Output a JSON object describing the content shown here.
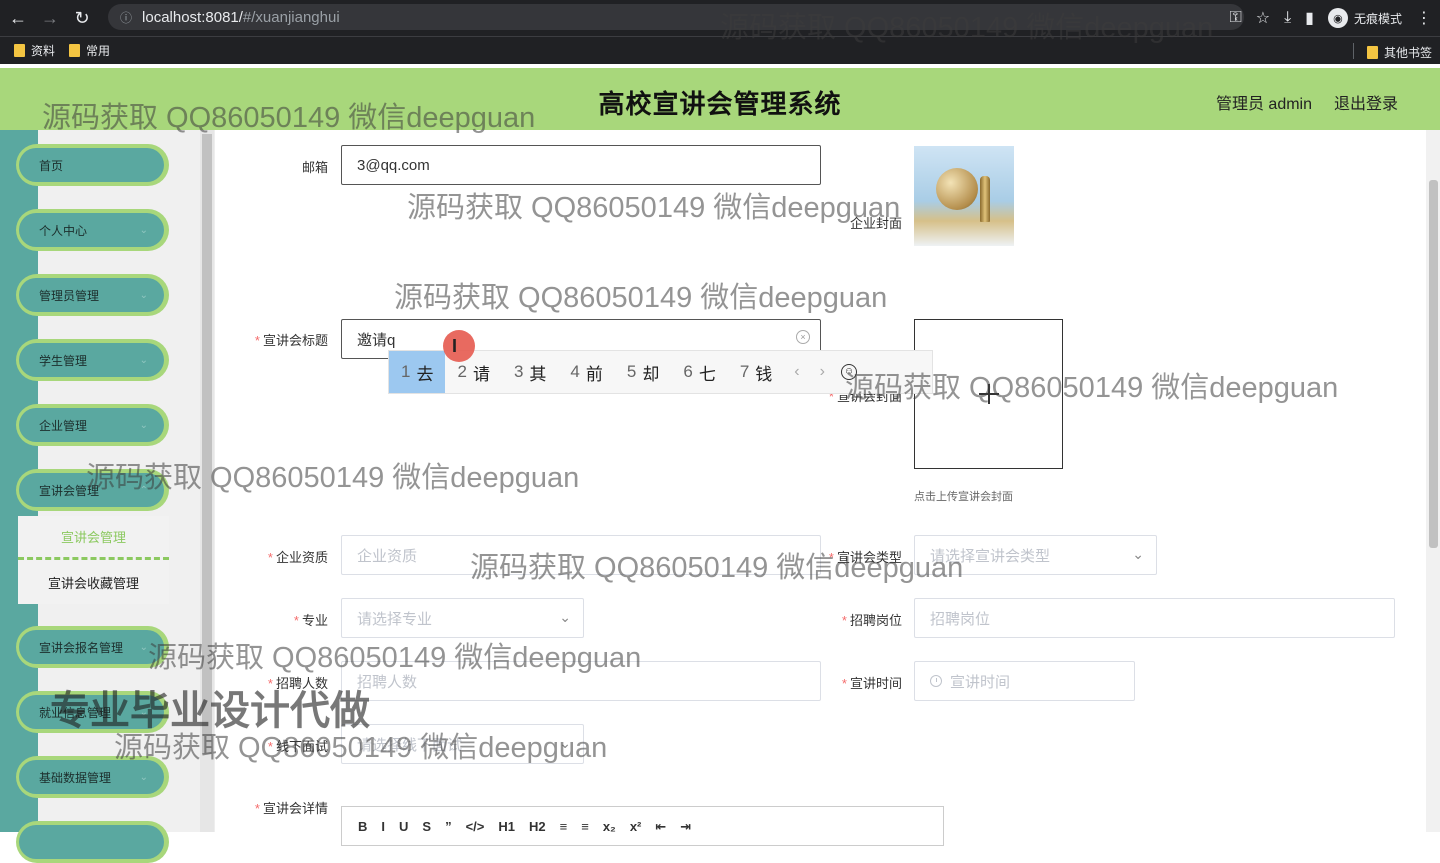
{
  "browser": {
    "url_host": "localhost:8081/",
    "url_path": "#/xuanjianghui",
    "incognito_label": "无痕模式",
    "bookmarks": [
      "资料",
      "常用"
    ],
    "other_bookmarks": "其他书签"
  },
  "header": {
    "title": "高校宣讲会管理系统",
    "user": "管理员 admin",
    "logout": "退出登录"
  },
  "sidebar": {
    "items": [
      "首页",
      "个人中心",
      "管理员管理",
      "学生管理",
      "企业管理",
      "宣讲会管理",
      "宣讲会报名管理",
      "就业信息管理",
      "基础数据管理"
    ],
    "submenu": [
      "宣讲会管理",
      "宣讲会收藏管理"
    ]
  },
  "form": {
    "email_label": "邮箱",
    "email_value": "3@qq.com",
    "cover_label": "企业封面",
    "title_label": "宣讲会标题",
    "title_value": "邀请q",
    "session_cover_label": "宣讲会封面",
    "upload_tip": "点击上传宣讲会封面",
    "qualification_label": "企业资质",
    "qualification_placeholder": "企业资质",
    "type_label": "宣讲会类型",
    "type_placeholder": "请选择宣讲会类型",
    "major_label": "专业",
    "major_placeholder": "请选择专业",
    "position_label": "招聘岗位",
    "position_placeholder": "招聘岗位",
    "count_label": "招聘人数",
    "count_placeholder": "招聘人数",
    "time_label": "宣讲时间",
    "time_placeholder": "宣讲时间",
    "offline_label": "线下面试",
    "offline_placeholder": "请选择线下面试",
    "detail_label": "宣讲会详情",
    "editor_tools": [
      "B",
      "I",
      "U",
      "S",
      "”",
      "</>",
      "H1",
      "H2",
      "≡",
      "≡",
      "x₂",
      "x²",
      "⇤",
      "⇥"
    ]
  },
  "ime": {
    "candidates": [
      {
        "num": "1",
        "text": "去"
      },
      {
        "num": "2",
        "text": "请"
      },
      {
        "num": "3",
        "text": "其"
      },
      {
        "num": "4",
        "text": "前"
      },
      {
        "num": "5",
        "text": "却"
      },
      {
        "num": "6",
        "text": "七"
      },
      {
        "num": "7",
        "text": "钱"
      }
    ]
  },
  "watermark": {
    "text": "源码获取 QQ86050149 微信deepguan",
    "big": "专业毕业设计代做"
  }
}
